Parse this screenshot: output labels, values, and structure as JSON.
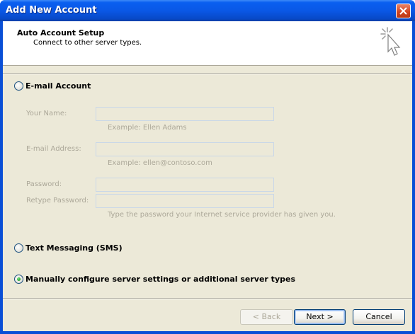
{
  "window": {
    "title": "Add New Account"
  },
  "header": {
    "title": "Auto Account Setup",
    "subtitle": "Connect to other server types."
  },
  "options": {
    "email_account": {
      "label": "E-mail Account",
      "selected": false
    },
    "sms": {
      "label": "Text Messaging (SMS)",
      "selected": false
    },
    "manual": {
      "label": "Manually configure server settings or additional server types",
      "selected": true
    }
  },
  "form": {
    "your_name": {
      "label": "Your Name:",
      "value": "",
      "hint": "Example: Ellen Adams"
    },
    "email_address": {
      "label": "E-mail Address:",
      "value": "",
      "hint": "Example: ellen@contoso.com"
    },
    "password": {
      "label": "Password:",
      "value": ""
    },
    "retype_password": {
      "label": "Retype Password:",
      "value": ""
    },
    "password_hint": "Type the password your Internet service provider has given you."
  },
  "buttons": {
    "back": "< Back",
    "next": "Next >",
    "cancel": "Cancel"
  }
}
